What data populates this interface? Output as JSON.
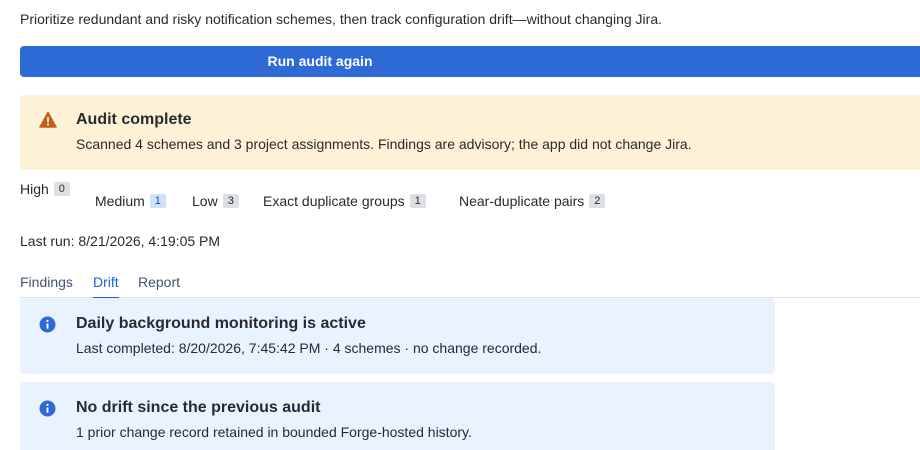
{
  "intro": "Prioritize redundant and risky notification schemes, then track configuration drift—without changing Jira.",
  "actions": {
    "run_audit_label": "Run audit again"
  },
  "audit_status": {
    "title": "Audit complete",
    "message": "Scanned 4 schemes and 3 project assignments. Findings are advisory; the app did not change Jira.",
    "icon": "warning-icon",
    "color": "#fdf2d8"
  },
  "stats": {
    "high": {
      "label": "High",
      "count": "0"
    },
    "medium": {
      "label": "Medium",
      "count": "1"
    },
    "low": {
      "label": "Low",
      "count": "3"
    },
    "exact_duplicates": {
      "label": "Exact duplicate groups",
      "count": "1"
    },
    "near_duplicates": {
      "label": "Near-duplicate pairs",
      "count": "2"
    }
  },
  "last_run": "Last run: 8/21/2026, 4:19:05 PM",
  "tabs": [
    {
      "label": "Findings",
      "active": false
    },
    {
      "label": "Drift",
      "active": true
    },
    {
      "label": "Report",
      "active": false
    }
  ],
  "drift": {
    "monitoring": {
      "title": "Daily background monitoring is active",
      "text": "Last completed: 8/20/2026, 7:45:42 PM · 4 schemes · no change recorded.",
      "icon": "info-icon"
    },
    "no_drift": {
      "title": "No drift since the previous audit",
      "text": "1 prior change record retained in bounded Forge-hosted history.",
      "icon": "info-icon"
    }
  },
  "colors": {
    "accent": "#2d6ad6",
    "tab_active": "#1e5fd0",
    "info_background": "#e9f2ff",
    "warning_icon": "#c25e1b",
    "info_icon": "#2d6ad6"
  }
}
